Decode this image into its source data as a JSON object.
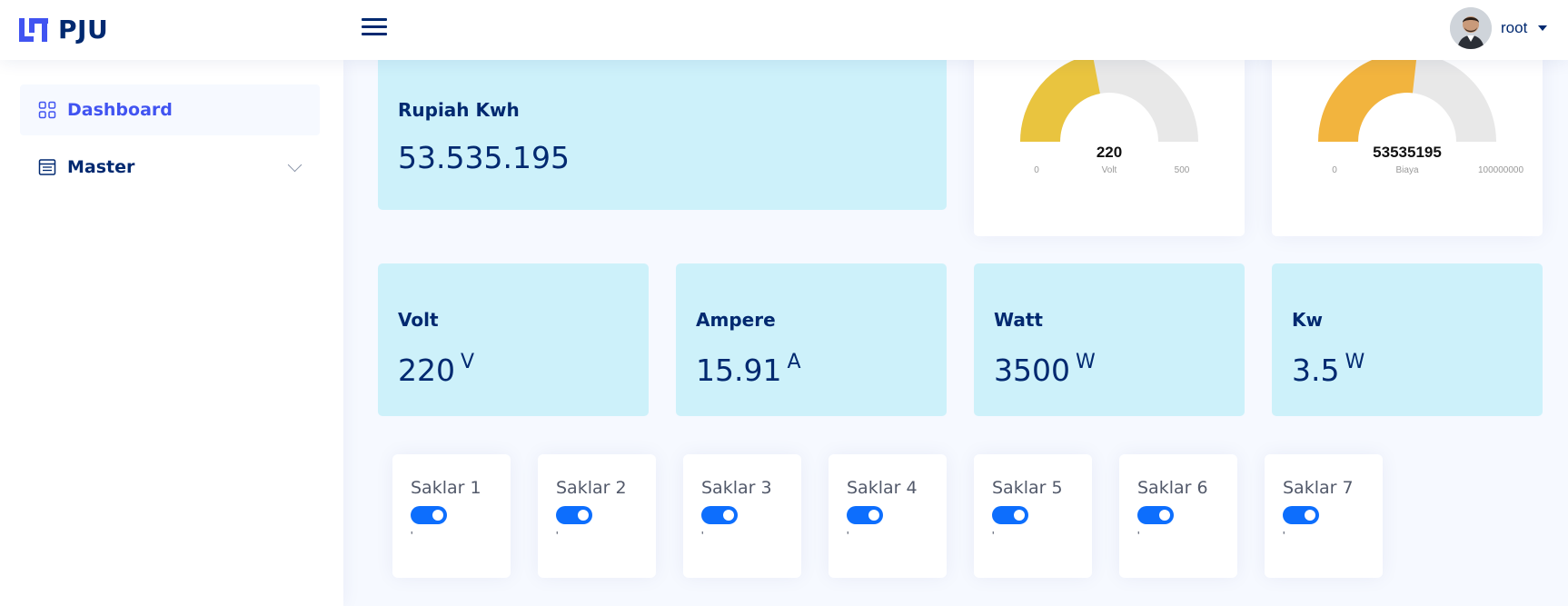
{
  "header": {
    "brand": "PJU",
    "user_name": "root"
  },
  "sidebar": {
    "items": [
      {
        "label": "Dashboard",
        "icon": "grid-icon",
        "active": true
      },
      {
        "label": "Master",
        "icon": "menu-button-icon",
        "active": false
      }
    ]
  },
  "cards": {
    "rupiah_kwh": {
      "title": "Rupiah Kwh",
      "value": "53.535.195"
    },
    "volt": {
      "title": "Volt",
      "value": "220",
      "unit": "V"
    },
    "ampere": {
      "title": "Ampere",
      "value": "15.91",
      "unit": "A"
    },
    "watt": {
      "title": "Watt",
      "value": "3500",
      "unit": "W"
    },
    "kw": {
      "title": "Kw",
      "value": "3.5",
      "unit": "W"
    }
  },
  "gauges": [
    {
      "value_label": "220",
      "min_label": "0",
      "max_label": "500",
      "unit_label": "Volt",
      "value": 220,
      "min": 0,
      "max": 500,
      "color": "#e9c43f"
    },
    {
      "value_label": "53535195",
      "min_label": "0",
      "max_label": "100000000",
      "unit_label": "Biaya",
      "value": 53535195,
      "min": 0,
      "max": 100000000,
      "color": "#f2b43e"
    }
  ],
  "switches": [
    {
      "label": "Saklar 1",
      "state_text": "'",
      "on": true
    },
    {
      "label": "Saklar 2",
      "state_text": "'",
      "on": true
    },
    {
      "label": "Saklar 3",
      "state_text": "'",
      "on": true
    },
    {
      "label": "Saklar 4",
      "state_text": "'",
      "on": true
    },
    {
      "label": "Saklar 5",
      "state_text": "'",
      "on": true
    },
    {
      "label": "Saklar 6",
      "state_text": "'",
      "on": true
    },
    {
      "label": "Saklar 7",
      "state_text": "'",
      "on": true
    }
  ],
  "colors": {
    "brand": "#012970",
    "accent": "#4154f1",
    "info_card": "#cdf1fa",
    "toggle_on": "#0d6efd",
    "gauge_track": "#e8e8e8"
  }
}
